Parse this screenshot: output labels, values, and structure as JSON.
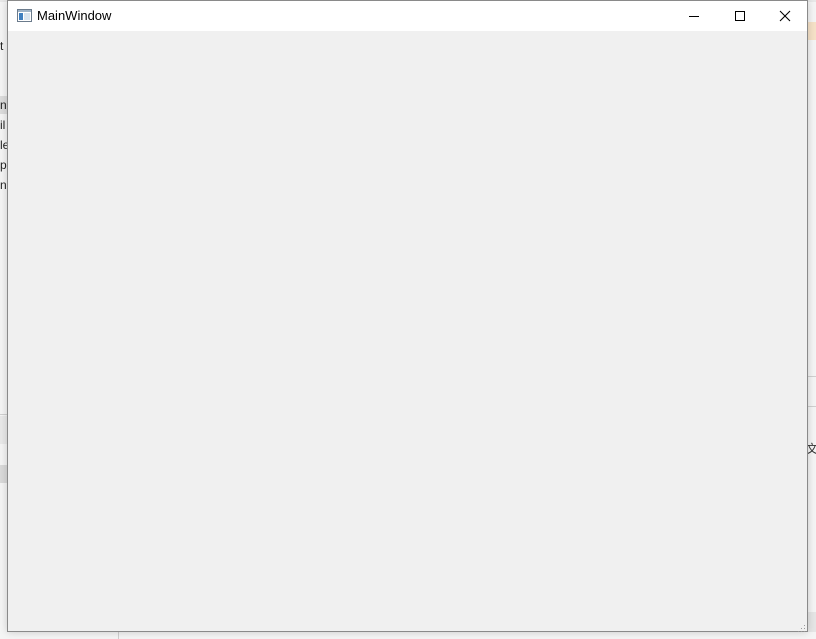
{
  "window": {
    "title": "MainWindow",
    "icons": {
      "app": "app-window-icon",
      "minimize": "minimize-icon",
      "maximize": "maximize-icon",
      "close": "close-icon"
    }
  },
  "background": {
    "left_fragments": [
      "t",
      "n",
      "il",
      "le",
      "p",
      "n"
    ],
    "right_fragment": "文件"
  },
  "colors": {
    "titlebar": "#ffffff",
    "client_area": "#f0f0f0",
    "border": "#8a8a8a"
  }
}
